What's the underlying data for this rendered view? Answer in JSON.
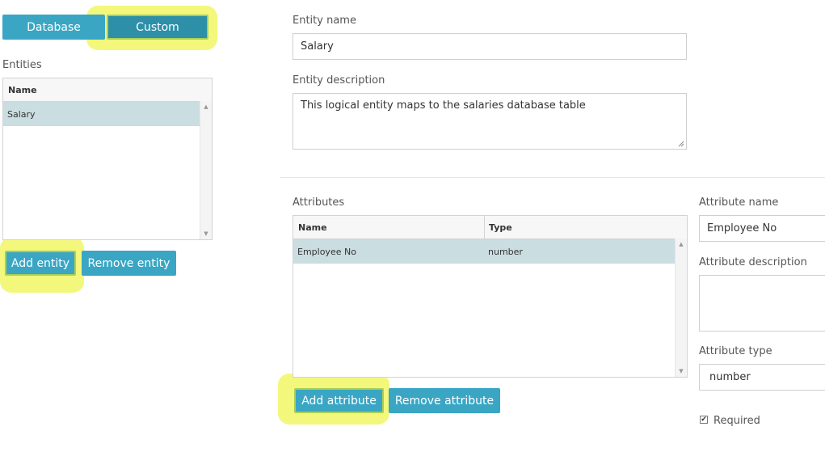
{
  "source_tabs": {
    "database": "Database",
    "custom": "Custom"
  },
  "entities": {
    "title": "Entities",
    "column": "Name",
    "rows": [
      "Salary"
    ],
    "add_label": "Add entity",
    "remove_label": "Remove entity"
  },
  "entity_form": {
    "name_label": "Entity name",
    "name_value": "Salary",
    "description_label": "Entity description",
    "description_value": "This logical entity maps to the salaries database table"
  },
  "attributes": {
    "title": "Attributes",
    "columns": [
      "Name",
      "Type"
    ],
    "rows": [
      {
        "name": "Employee No",
        "type": "number"
      }
    ],
    "add_label": "Add attribute",
    "remove_label": "Remove attribute"
  },
  "attribute_form": {
    "name_label": "Attribute name",
    "name_value": "Employee No",
    "description_label": "Attribute description",
    "description_value": "",
    "type_label": "Attribute type",
    "type_value": "number",
    "required_label": "Required",
    "required_checked": true
  },
  "colors": {
    "button": "#3aa6c4",
    "selected_row": "#cadde1",
    "highlight": "#f3f77c"
  }
}
